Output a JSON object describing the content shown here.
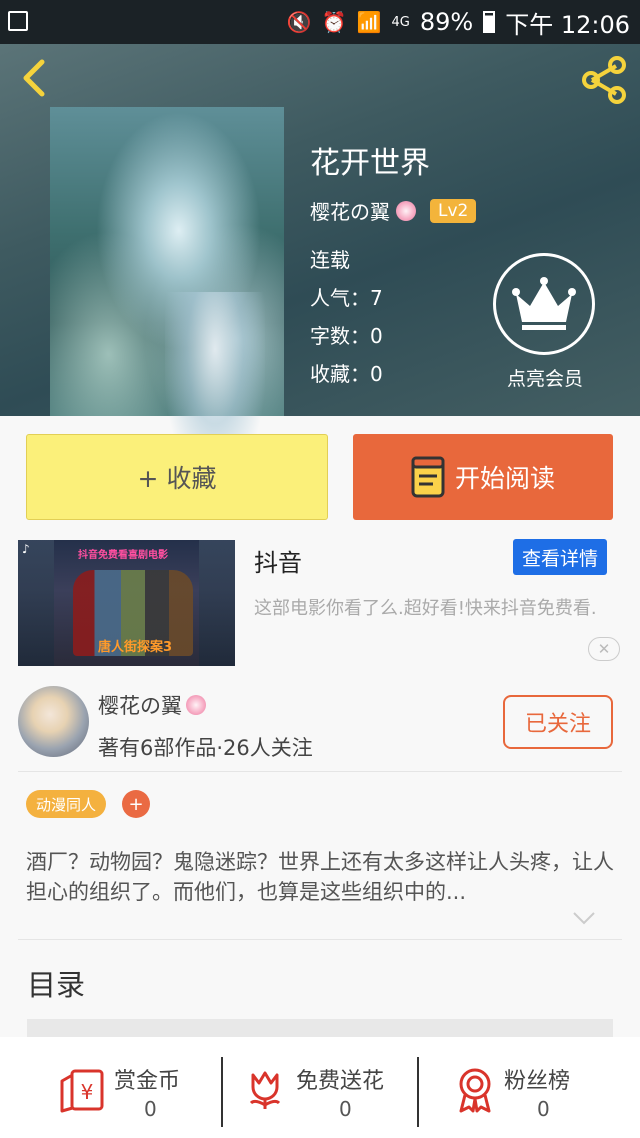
{
  "status_bar": {
    "battery": "89%",
    "time": "下午 12:06",
    "network": "4G"
  },
  "book": {
    "title": "花开世界",
    "author": "樱花の翼",
    "level": "Lv2",
    "status": "连载",
    "popularity": "人气：7",
    "word_count": "字数：0",
    "favorites": "收藏：0"
  },
  "vip": {
    "label": "点亮会员"
  },
  "actions": {
    "collect_label": "+ 收藏",
    "read_label": "开始阅读"
  },
  "ad": {
    "title": "抖音",
    "detail_button": "查看详情",
    "description": "这部电影你看了么.超好看!快来抖音免费看.",
    "image_top_text": "抖音免费看喜剧电影",
    "image_bottom_text": "唐人街探案3"
  },
  "author_card": {
    "name": "樱花の翼",
    "stats": "著有6部作品·26人关注",
    "follow_button": "已关注"
  },
  "tags": {
    "items": [
      "动漫同人"
    ],
    "add_label": "+"
  },
  "synopsis": "酒厂？动物园？鬼隐迷踪？世界上还有太多这样让人头疼，让人担心的组织了。而他们，也算是这些组织中的...",
  "toc": {
    "title": "目录"
  },
  "bottom_bar": {
    "items": [
      {
        "label": "赏金币",
        "count": "0",
        "icon": "reward-coin-icon"
      },
      {
        "label": "免费送花",
        "count": "0",
        "icon": "flower-icon"
      },
      {
        "label": "粉丝榜",
        "count": "0",
        "icon": "medal-icon"
      }
    ]
  },
  "colors": {
    "accent_orange": "#e8683c",
    "collect_yellow": "#fbf07a",
    "back_arrow_yellow": "#f5d33c",
    "level_badge": "#f3b43b",
    "ad_button_blue": "#1e6ee6",
    "icon_red": "#d9342b"
  }
}
